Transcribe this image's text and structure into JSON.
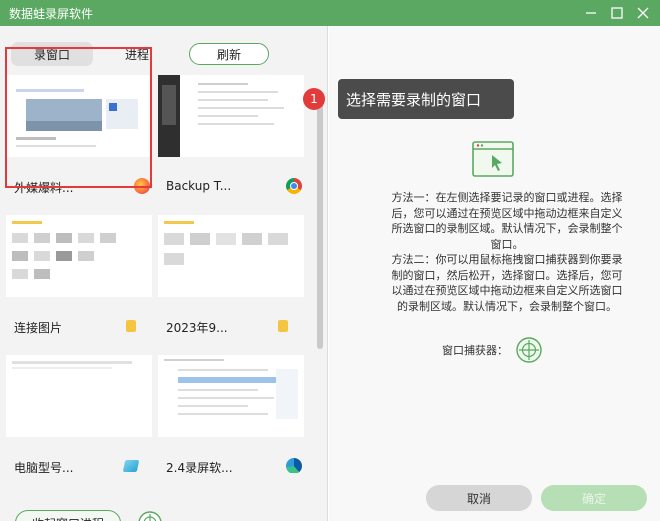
{
  "window": {
    "title": "数据蛙录屏软件"
  },
  "tabs": {
    "record_window": "录窗口",
    "process": "进程",
    "refresh": "刷新"
  },
  "windows_grid": [
    {
      "label": "外媒爆料...",
      "app_icon": "firefox-icon"
    },
    {
      "label": "Backup T...",
      "app_icon": "chrome-icon"
    },
    {
      "label": "连接图片",
      "app_icon": "folder-icon"
    },
    {
      "label": "2023年9...",
      "app_icon": "folder-icon"
    },
    {
      "label": "电脑型号...",
      "app_icon": "note-icon"
    },
    {
      "label": "2.4录屏软...",
      "app_icon": "edge-icon"
    }
  ],
  "tooltip": {
    "step": "1",
    "text": "选择需要录制的窗口"
  },
  "instructions": {
    "method1": "方法一：在左侧选择要记录的窗口或进程。选择后，您可以通过在预览区域中拖动边框来自定义所选窗口的录制区域。默认情况下，会录制整个窗口。",
    "method2": "方法二：你可以用鼠标拖拽窗口捕获器到你要录制的窗口，然后松开，选择窗口。选择后，您可以通过在预览区域中拖动边框来自定义所选窗口的录制区域。默认情况下，会录制整个窗口。",
    "capturer_label": "窗口捕获器："
  },
  "buttons": {
    "collapse": "收起窗口进程",
    "cancel": "取消",
    "ok": "确定"
  },
  "colors": {
    "accent": "#5aa861",
    "selected_border": "#e23b3b"
  }
}
